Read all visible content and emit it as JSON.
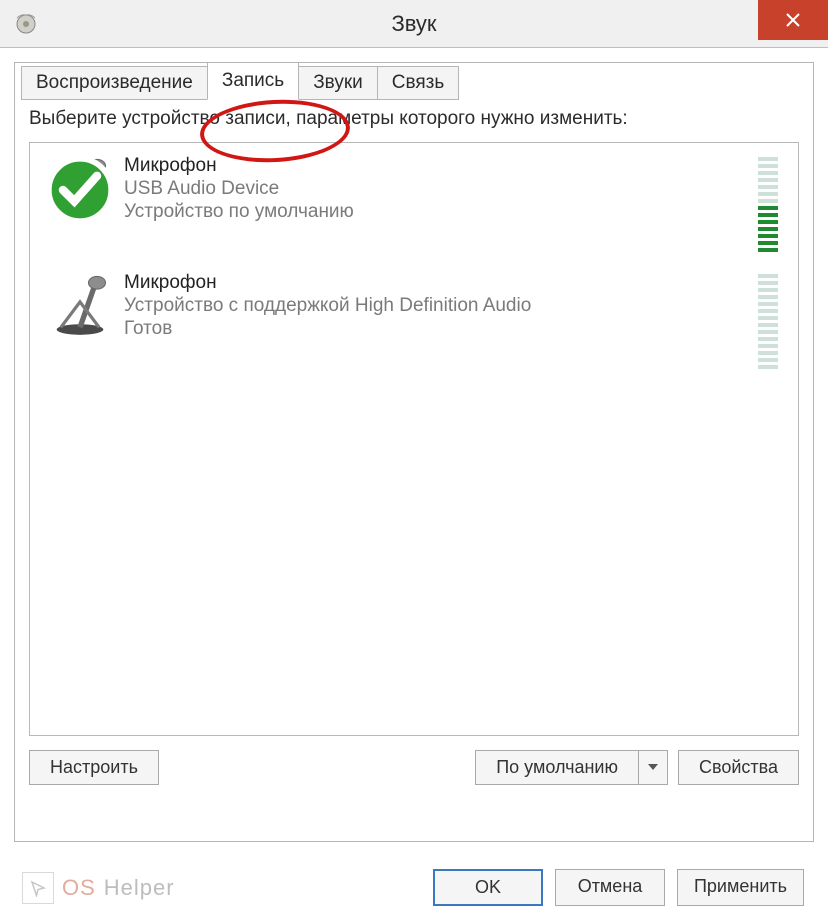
{
  "window": {
    "title": "Звук"
  },
  "tabs": [
    {
      "label": "Воспроизведение",
      "active": false
    },
    {
      "label": "Запись",
      "active": true
    },
    {
      "label": "Звуки",
      "active": false
    },
    {
      "label": "Связь",
      "active": false
    }
  ],
  "instruction": "Выберите устройство записи, параметры которого нужно изменить:",
  "devices": [
    {
      "title": "Микрофон",
      "line1": "USB Audio Device",
      "line2": "Устройство по умолчанию",
      "default_badge": true,
      "meter_active_segments": 7,
      "meter_total_segments": 14
    },
    {
      "title": "Микрофон",
      "line1": "Устройство с поддержкой High Definition Audio",
      "line2": "Готов",
      "default_badge": false,
      "meter_active_segments": 0,
      "meter_total_segments": 14
    }
  ],
  "buttons": {
    "configure": "Настроить",
    "set_default": "По умолчанию",
    "properties": "Свойства",
    "ok": "OK",
    "cancel": "Отмена",
    "apply": "Применить"
  },
  "watermark": {
    "part1": "OS",
    "part2": "Helper"
  }
}
